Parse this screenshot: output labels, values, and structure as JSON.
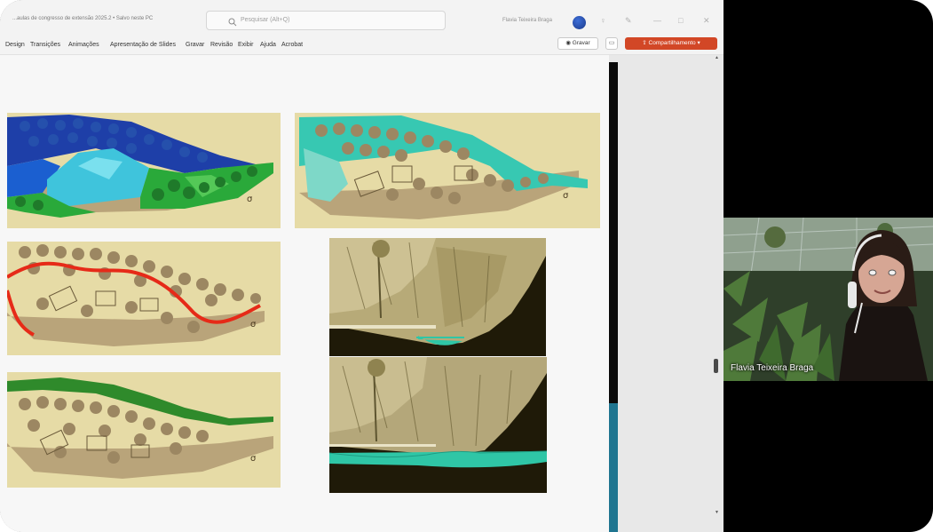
{
  "window": {
    "title": "...aulas de congresso de extensão 2025.2 • Salvo neste PC",
    "user_name": "Flavia Teixeira Braga"
  },
  "search": {
    "placeholder": "Pesquisar (Alt+Q)"
  },
  "ribbon": {
    "menu": [
      "Design",
      "Transições",
      "Animações",
      "Apresentação de Slides",
      "Gravar",
      "Revisão",
      "Exibir",
      "Ajuda",
      "Acrobat"
    ],
    "record_label": "Gravar",
    "share_label": "Compartilhamento"
  },
  "video": {
    "participant_name": "Flavia Teixeira Braga"
  },
  "colors": {
    "share": "#d24726",
    "scroll_thumb": "#1f7590",
    "panel_bg": "#e6dba6",
    "blue": "#1e3fa8",
    "cyan": "#3fc4dc",
    "green": "#2aa93a",
    "teal": "#37c8b2",
    "red": "#e62a18",
    "forest": "#2f8a2b"
  },
  "icons": [
    "search-icon",
    "avatar",
    "lightbulb-icon",
    "pen-icon",
    "minimize-icon",
    "maximize-icon",
    "close-icon",
    "record-icon",
    "comment-icon",
    "share-icon"
  ]
}
